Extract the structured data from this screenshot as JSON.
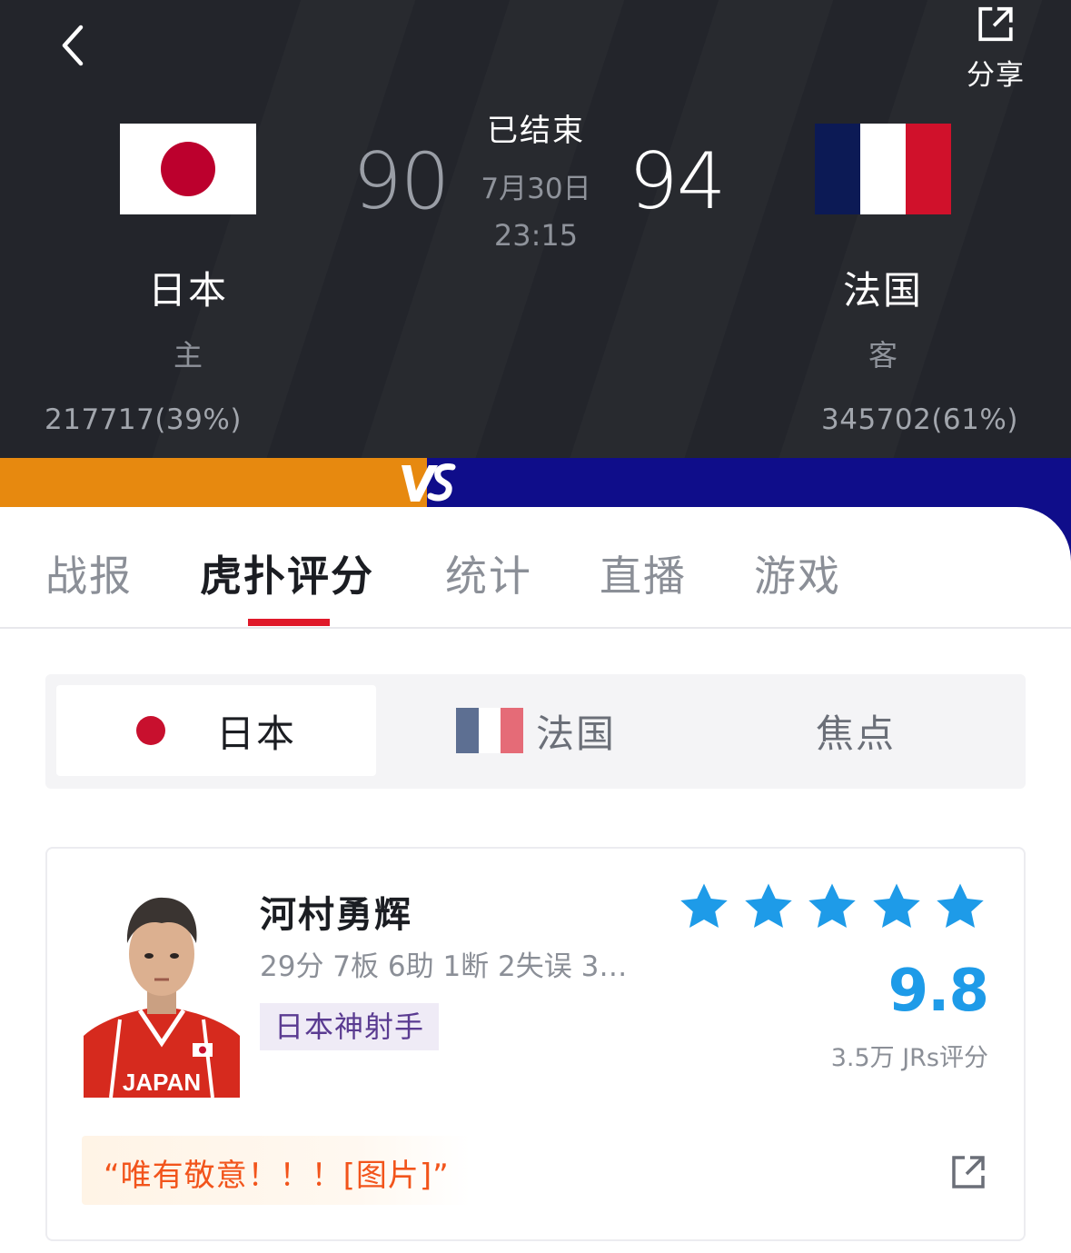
{
  "header": {
    "share_label": "分享",
    "status": "已结束",
    "date": "7月30日",
    "time": "23:15",
    "home": {
      "name": "日本",
      "role": "主",
      "score": "90",
      "votes": "217717(39%)",
      "flag": "japan-flag"
    },
    "away": {
      "name": "法国",
      "role": "客",
      "score": "94",
      "votes": "345702(61%)",
      "flag": "france-flag"
    },
    "vs_label": "VS",
    "colors": {
      "background": "#23252b",
      "home_band": "#e7890f",
      "away_band": "#0f0d8a"
    }
  },
  "tabs": [
    {
      "label": "战报",
      "active": false
    },
    {
      "label": "虎扑评分",
      "active": true
    },
    {
      "label": "统计",
      "active": false
    },
    {
      "label": "直播",
      "active": false
    },
    {
      "label": "游戏",
      "active": false
    }
  ],
  "team_switch": [
    {
      "label": "日本",
      "icon": "japan-flag-icon",
      "active": true
    },
    {
      "label": "法国",
      "icon": "france-flag-icon",
      "active": false
    },
    {
      "label": "焦点",
      "icon": "",
      "active": false
    }
  ],
  "player_card": {
    "name": "河村勇辉",
    "stats": "29分 7板 6助 1断 2失误 3…",
    "tag": "日本神射手",
    "stars": 5,
    "rating": "9.8",
    "rating_count": "3.5万 JRs评分",
    "comment": "“唯有敬意！！！[图片]”",
    "jersey_text": "JAPAN",
    "colors": {
      "star": "#1e9be8",
      "rating": "#1e9be8",
      "tag_text": "#5a3b91",
      "comment_text": "#f2541b"
    }
  }
}
